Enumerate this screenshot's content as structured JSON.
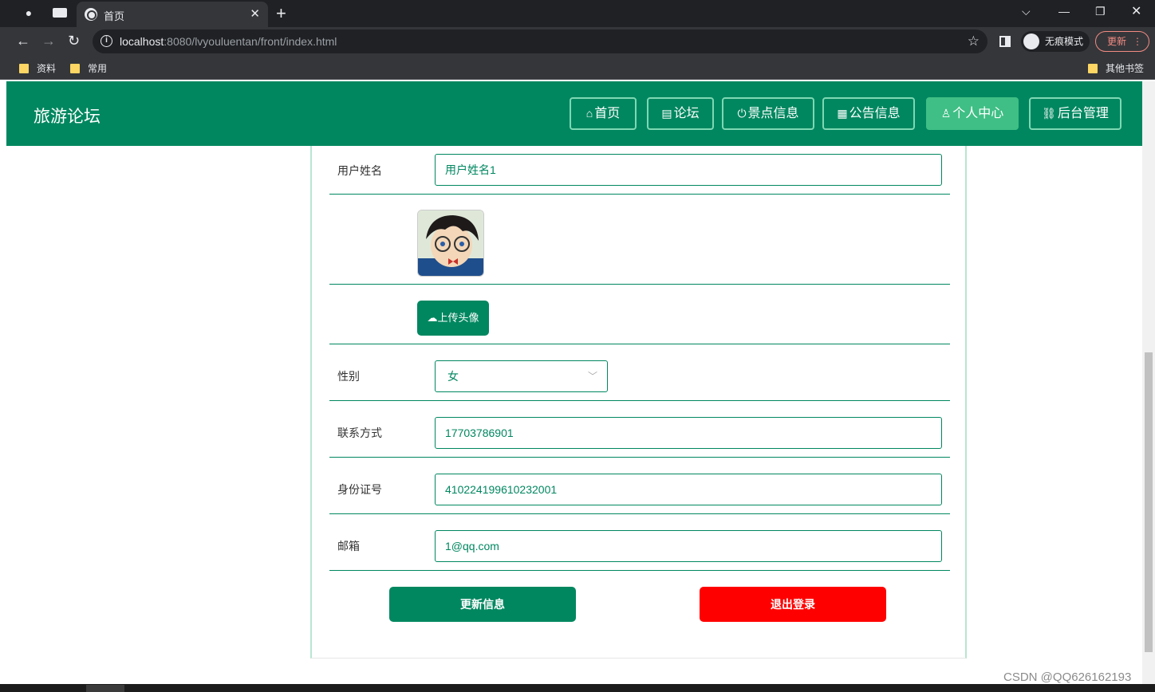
{
  "browser": {
    "tab_title": "首页",
    "url_host": "localhost",
    "url_rest": ":8080/lvyouluentan/front/index.html",
    "incognito_label": "无痕模式",
    "update_label": "更新",
    "bookmarks": [
      "资料",
      "常用"
    ],
    "other_bookmarks": "其他书签"
  },
  "site": {
    "logo": "旅游论坛",
    "nav": [
      {
        "label": "首页",
        "icon": "home-icon",
        "active": false
      },
      {
        "label": "论坛",
        "icon": "document-icon",
        "active": false
      },
      {
        "label": "景点信息",
        "icon": "power-icon",
        "active": false
      },
      {
        "label": "公告信息",
        "icon": "grid-icon",
        "active": false
      },
      {
        "label": "个人中心",
        "icon": "user-icon",
        "active": true
      },
      {
        "label": "后台管理",
        "icon": "link-icon",
        "active": false
      }
    ]
  },
  "form": {
    "name_label": "用户姓名",
    "name_value": "用户姓名1",
    "upload_label": "上传头像",
    "gender_label": "性别",
    "gender_value": "女",
    "phone_label": "联系方式",
    "phone_value": "17703786901",
    "id_label": "身份证号",
    "id_value": "410224199610232001",
    "email_label": "邮箱",
    "email_value": "1@qq.com",
    "update_button": "更新信息",
    "logout_button": "退出登录"
  },
  "colors": {
    "primary": "#00875f",
    "active_nav": "#3fbf85",
    "logout": "#ff0000"
  },
  "watermark": "CSDN @QQ626162193"
}
